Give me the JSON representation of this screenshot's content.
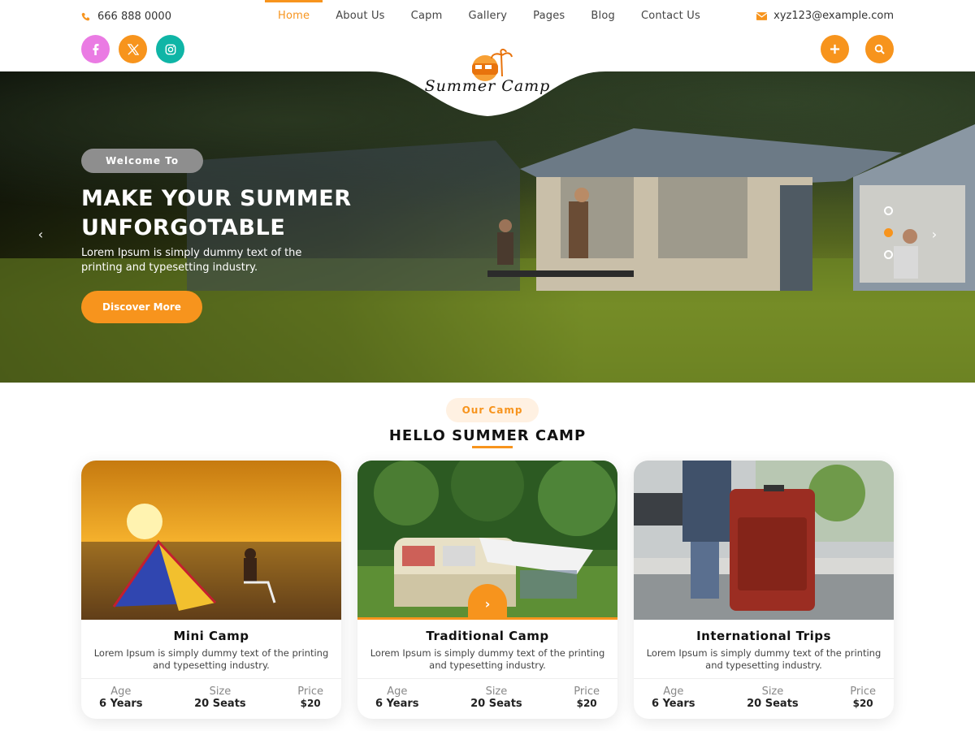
{
  "header": {
    "phone": "666 888 0000",
    "email": "xyz123@example.com",
    "nav": [
      "Home",
      "About Us",
      "Capm",
      "Gallery",
      "Pages",
      "Blog",
      "Contact Us"
    ],
    "active_nav": "Home",
    "socials": [
      "facebook-icon",
      "x-icon",
      "instagram-icon"
    ],
    "logo_text": "Summer Camp"
  },
  "hero": {
    "pill": "Welcome To",
    "title_line1": "MAKE YOUR SUMMER",
    "title_line2": "UNFORGOTABLE",
    "sub_line1": "Lorem Ipsum is simply dummy text of the",
    "sub_line2": "printing and typesetting industry.",
    "button": "Discover More",
    "prev_arrow": "‹",
    "next_arrow": "›",
    "slides": 3,
    "active_slide": 2
  },
  "section": {
    "pill": "Our Camp",
    "title": "HELLO SUMMER CAMP"
  },
  "cards": [
    {
      "name": "Mini Camp",
      "desc": "Lorem Ipsum is simply dummy text of the printing and typesetting industry.",
      "age_label": "Age",
      "age": "6 Years",
      "size_label": "Size",
      "size": "20 Seats",
      "price_label": "Price",
      "price": "$20"
    },
    {
      "name": "Traditional Camp",
      "desc": "Lorem Ipsum is simply dummy text of the printing and typesetting industry.",
      "age_label": "Age",
      "age": "6 Years",
      "size_label": "Size",
      "size": "20 Seats",
      "price_label": "Price",
      "price": "$20"
    },
    {
      "name": "International Trips",
      "desc": "Lorem Ipsum is simply dummy text of the printing and typesetting industry.",
      "age_label": "Age",
      "age": "6 Years",
      "size_label": "Size",
      "size": "20 Seats",
      "price_label": "Price",
      "price": "$20"
    }
  ],
  "colors": {
    "accent": "#f7941d",
    "facebook": "#ea7be3",
    "instagram": "#0fb5a6"
  }
}
